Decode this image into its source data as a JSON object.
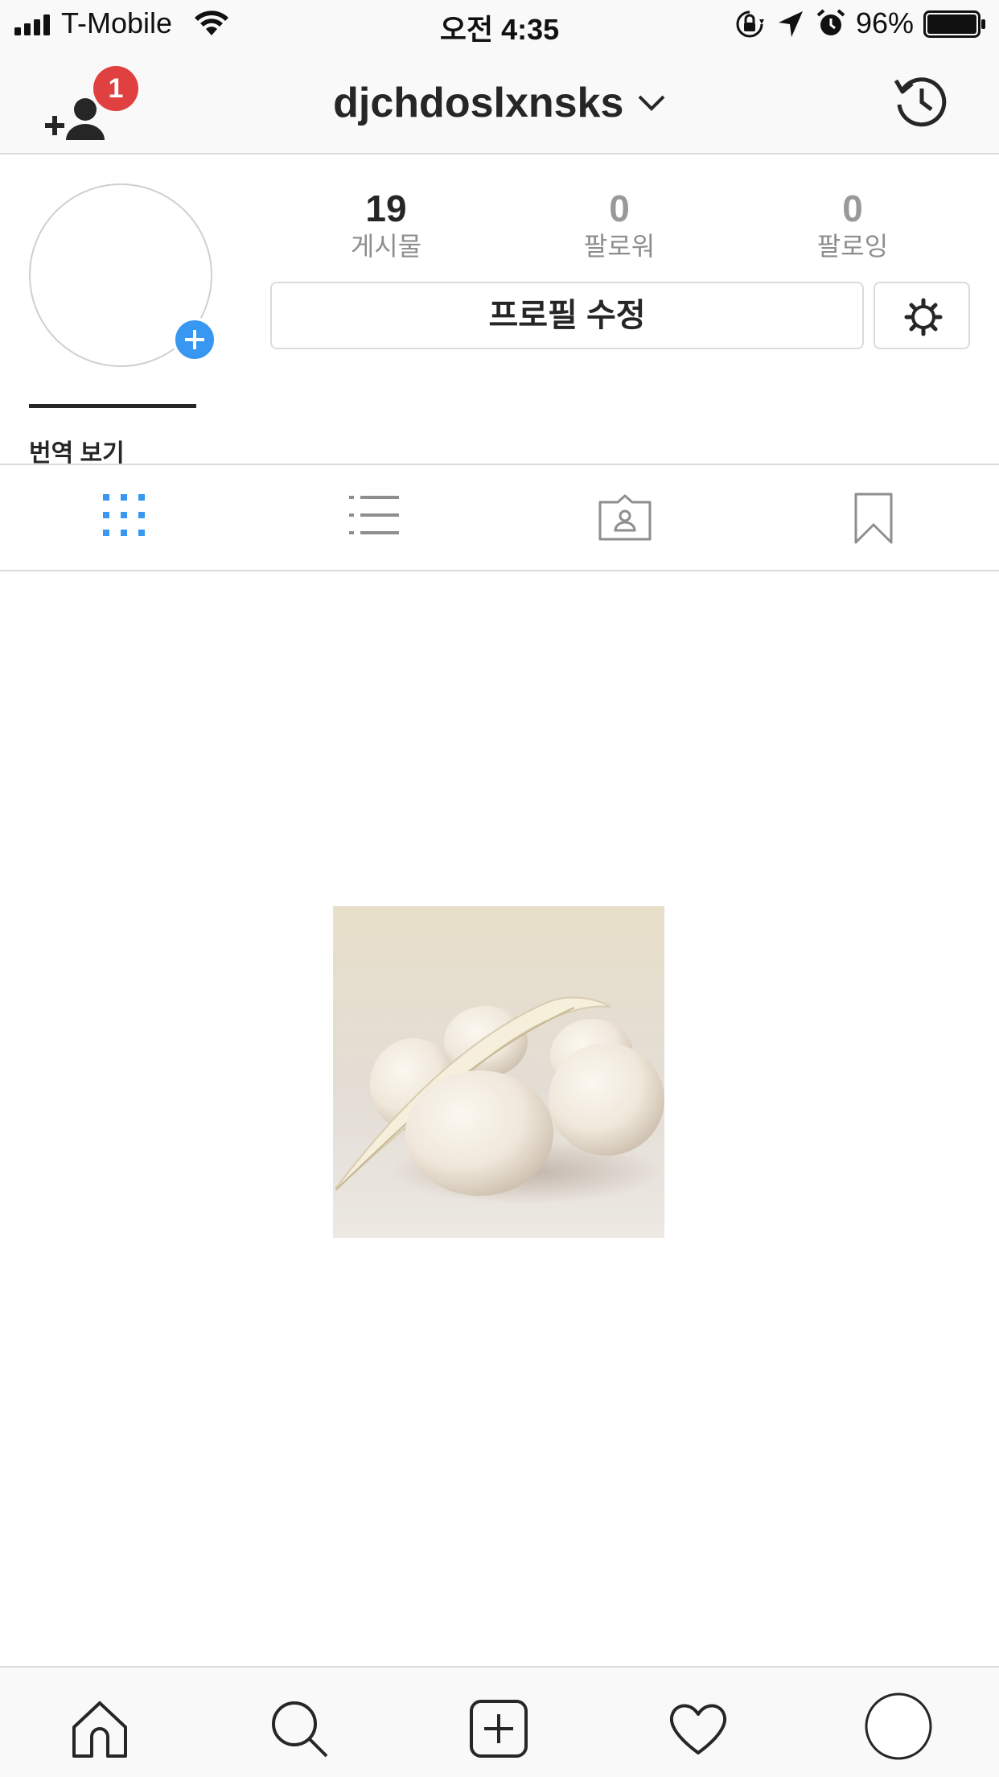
{
  "status_bar": {
    "carrier": "T-Mobile",
    "time": "오전 4:35",
    "battery_percent": "96%",
    "icons": [
      "signal-icon",
      "wifi-icon",
      "rotation-lock-icon",
      "location-arrow-icon",
      "alarm-icon",
      "battery-icon"
    ]
  },
  "header": {
    "username": "djchdoslxnsks",
    "notification_count": "1",
    "icons": [
      "add-friend-icon",
      "chevron-down-icon",
      "history-icon"
    ]
  },
  "profile": {
    "stats": [
      {
        "value": "19",
        "label": "게시물"
      },
      {
        "value": "0",
        "label": "팔로워"
      },
      {
        "value": "0",
        "label": "팔로잉"
      }
    ],
    "edit_profile_label": "프로필 수정",
    "clipped_text": "번역 보기"
  },
  "tabs": [
    {
      "name": "grid",
      "icon": "grid-icon",
      "active": true
    },
    {
      "name": "list",
      "icon": "list-icon",
      "active": false
    },
    {
      "name": "tagged",
      "icon": "tagged-icon",
      "active": false
    },
    {
      "name": "saved",
      "icon": "bookmark-icon",
      "active": false
    }
  ],
  "bottom_nav": [
    "home-icon",
    "search-icon",
    "add-post-icon",
    "heart-icon",
    "profile-icon"
  ],
  "colors": {
    "accent_blue": "#3897f0",
    "badge_red": "#e0403f",
    "text_dark": "#262626",
    "text_muted": "#8e8e8e",
    "divider": "#dbdbdb",
    "bar_bg": "#f9f9f9"
  }
}
